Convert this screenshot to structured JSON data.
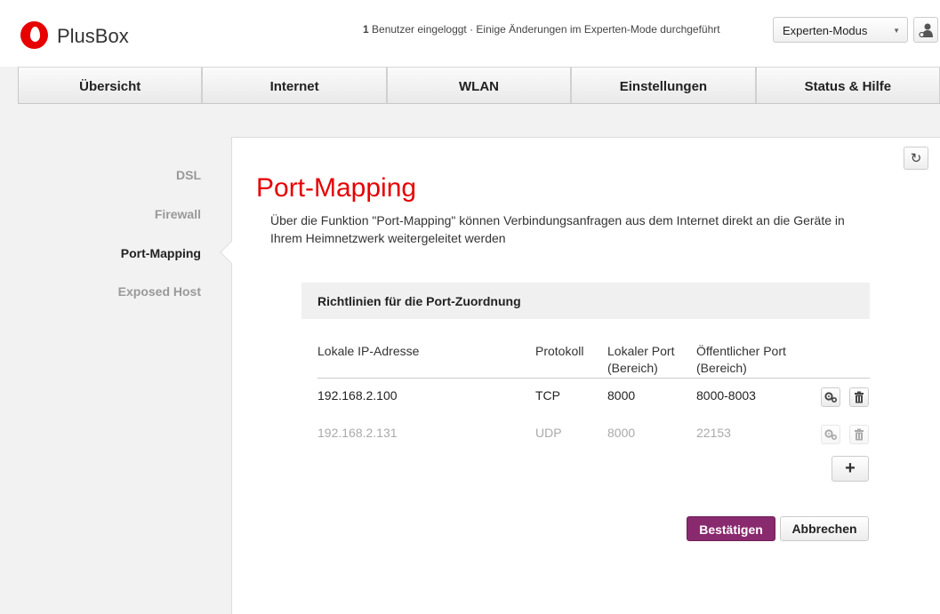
{
  "header": {
    "brand": "PlusBox",
    "status_count": "1",
    "status_text": " Benutzer eingeloggt · Einige Änderungen im Experten-Mode durchgeführt",
    "mode_select_value": "Experten-Modus"
  },
  "nav": {
    "tabs": [
      {
        "label": "Übersicht"
      },
      {
        "label": "Internet"
      },
      {
        "label": "WLAN"
      },
      {
        "label": "Einstellungen"
      },
      {
        "label": "Status & Hilfe"
      }
    ]
  },
  "sidebar": {
    "items": [
      {
        "label": "DSL"
      },
      {
        "label": "Firewall"
      },
      {
        "label": "Port-Mapping"
      },
      {
        "label": "Exposed Host"
      }
    ],
    "active": "Port-Mapping"
  },
  "main": {
    "title": "Port-Mapping",
    "description": "Über die Funktion \"Port-Mapping\" können Verbindungsanfragen aus dem Internet direkt an die Geräte in Ihrem Heimnetzwerk weitergeleitet werden",
    "section_title": "Richtlinien für die Port-Zuordnung",
    "columns": [
      "Lokale IP-Adresse",
      "Protokoll",
      "Lokaler Port (Bereich)",
      "Öffentlicher Port (Bereich)"
    ],
    "rows": [
      {
        "ip": "192.168.2.100",
        "protocol": "TCP",
        "local_port": "8000",
        "public_port": "8000-8003",
        "enabled": true
      },
      {
        "ip": "192.168.2.131",
        "protocol": "UDP",
        "local_port": "8000",
        "public_port": "22153",
        "enabled": false
      }
    ],
    "add_label": "+",
    "confirm_label": "Bestätigen",
    "cancel_label": "Abbrechen"
  },
  "colors": {
    "brand_red": "#e60000",
    "confirm_purple": "#8a2a6e"
  }
}
